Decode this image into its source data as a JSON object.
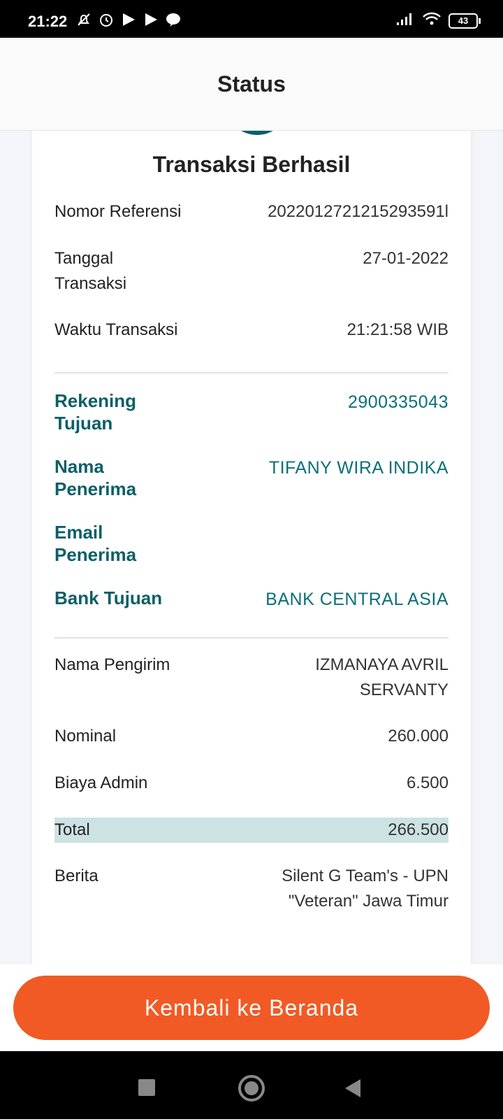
{
  "status_bar": {
    "time": "21:22",
    "battery": "43",
    "icons": [
      "mute-icon",
      "alarm-icon",
      "play-icon",
      "play-icon",
      "line-icon",
      "signal-icon",
      "wifi-icon",
      "battery-icon"
    ]
  },
  "header": {
    "title": "Status"
  },
  "card": {
    "title": "Transaksi Berhasil",
    "reference": {
      "label": "Nomor Referensi",
      "value": "2022012721215293591l"
    },
    "date": {
      "label": "Tanggal\nTransaksi",
      "value": "27-01-2022"
    },
    "time": {
      "label": "Waktu Transaksi",
      "value": "21:21:58 WIB"
    },
    "account": {
      "label": "Rekening\nTujuan",
      "value": "2900335043"
    },
    "recipient": {
      "label": "Nama\nPenerima",
      "value": "TIFANY WIRA INDIKA"
    },
    "email": {
      "label": "Email\nPenerima",
      "value": ""
    },
    "bank": {
      "label": "Bank Tujuan",
      "value": "BANK CENTRAL ASIA"
    },
    "sender": {
      "label": "Nama Pengirim",
      "value": "IZMANAYA AVRIL\nSERVANTY"
    },
    "nominal": {
      "label": "Nominal",
      "value": "260.000"
    },
    "admin_fee": {
      "label": "Biaya Admin",
      "value": "6.500"
    },
    "total": {
      "label": "Total",
      "value": "266.500"
    },
    "message": {
      "label": "Berita",
      "value": "Silent G Team's - UPN\n\"Veteran\" Jawa Timur"
    }
  },
  "actions": {
    "home_button": "Kembali ke Beranda"
  },
  "colors": {
    "accent_teal": "#0b5f66",
    "cta_orange": "#f15a24",
    "total_highlight": "#cde2e3"
  }
}
